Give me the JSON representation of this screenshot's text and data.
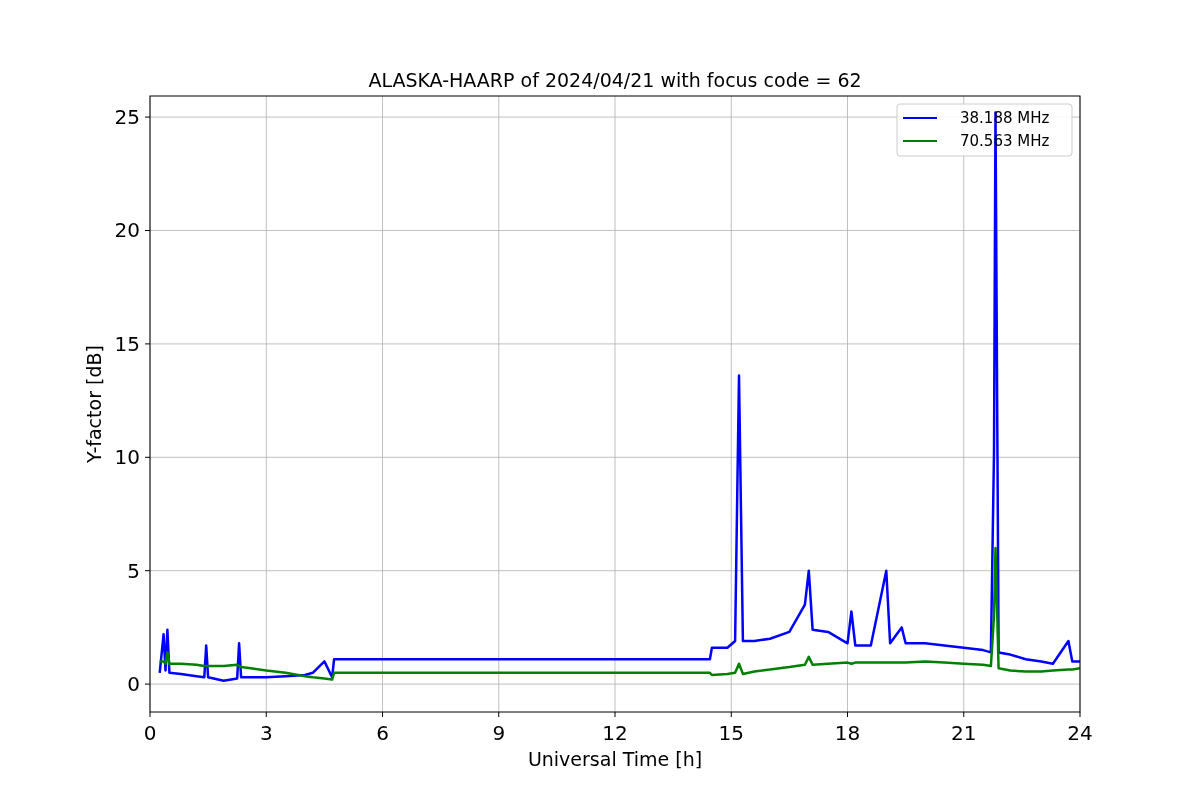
{
  "figure": {
    "chart_data": {
      "type": "line",
      "title": "ALASKA-HAARP of 2024/04/21 with focus code = 62",
      "xlabel": "Universal Time [h]",
      "ylabel": "Y-factor [dB]",
      "x": [
        0.25,
        0.35,
        0.4,
        0.45,
        0.5,
        0.8,
        1.2,
        1.4,
        1.45,
        1.5,
        1.9,
        2.25,
        2.3,
        2.35,
        2.6,
        3.0,
        3.5,
        4.0,
        4.2,
        4.5,
        4.7,
        4.75,
        9,
        14.45,
        14.5,
        14.9,
        15.1,
        15.2,
        15.3,
        15.6,
        16.0,
        16.5,
        16.9,
        17.0,
        17.1,
        17.5,
        18.0,
        18.1,
        18.2,
        18.6,
        19.0,
        19.1,
        19.4,
        19.5,
        20.0,
        20.5,
        21.0,
        21.5,
        21.7,
        21.78,
        21.82,
        21.9,
        22.2,
        22.6,
        23.0,
        23.3,
        23.7,
        23.8,
        24.0
      ],
      "series": [
        {
          "name": "38.188 MHz",
          "color": "#0000ff",
          "values": [
            0.5,
            2.2,
            0.6,
            2.4,
            0.5,
            0.45,
            0.35,
            0.3,
            1.7,
            0.3,
            0.15,
            0.25,
            1.8,
            0.3,
            0.3,
            0.3,
            0.35,
            0.4,
            0.5,
            1.0,
            0.3,
            1.1,
            1.1,
            1.1,
            1.6,
            1.6,
            1.9,
            13.6,
            1.9,
            1.9,
            2.0,
            2.3,
            3.5,
            5.0,
            2.4,
            2.3,
            1.8,
            3.2,
            1.7,
            1.7,
            5.0,
            1.8,
            2.5,
            1.8,
            1.8,
            1.7,
            1.6,
            1.5,
            1.4,
            10.2,
            25.2,
            1.4,
            1.3,
            1.1,
            1.0,
            0.9,
            1.9,
            1.0,
            1.0
          ]
        },
        {
          "name": "70.563 MHz",
          "color": "#008000",
          "values": [
            1.0,
            1.0,
            0.9,
            1.4,
            0.9,
            0.9,
            0.85,
            0.8,
            0.8,
            0.8,
            0.8,
            0.85,
            0.8,
            0.75,
            0.7,
            0.6,
            0.5,
            0.35,
            0.3,
            0.25,
            0.2,
            0.5,
            0.5,
            0.5,
            0.4,
            0.45,
            0.5,
            0.9,
            0.45,
            0.55,
            0.65,
            0.75,
            0.85,
            1.2,
            0.85,
            0.9,
            0.95,
            0.9,
            0.95,
            0.95,
            0.95,
            0.95,
            0.95,
            0.95,
            1.0,
            0.95,
            0.9,
            0.85,
            0.8,
            3.0,
            6.0,
            0.7,
            0.6,
            0.55,
            0.55,
            0.6,
            0.65,
            0.65,
            0.7
          ]
        }
      ],
      "xlim": [
        0,
        24
      ],
      "ylim": [
        -1.23,
        25.93
      ],
      "xticks": [
        0,
        3,
        6,
        9,
        12,
        15,
        18,
        21,
        24
      ],
      "yticks": [
        0,
        5,
        10,
        15,
        20,
        25
      ],
      "grid": true,
      "legend": true
    }
  }
}
